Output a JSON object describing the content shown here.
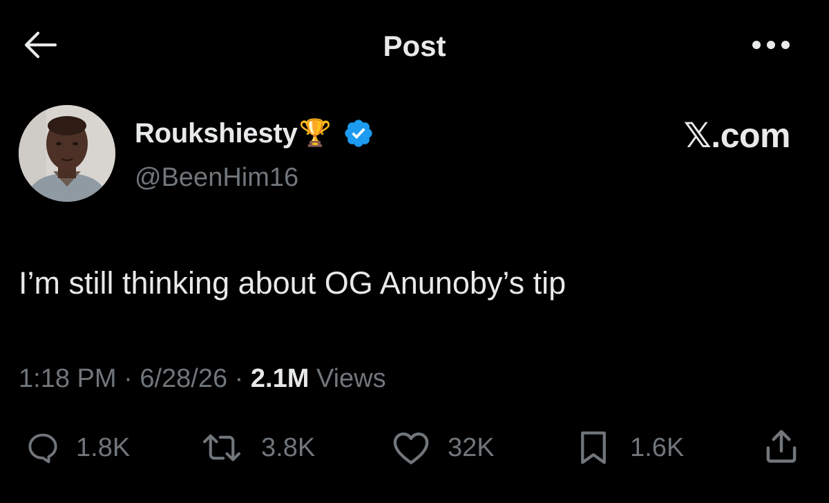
{
  "header": {
    "title": "Post",
    "back_icon": "arrow-left-icon",
    "more_icon": "more-horizontal-icon"
  },
  "author": {
    "display_name": "Roukshiesty",
    "emoji": "🏆",
    "handle": "@BeenHim16",
    "verified": true,
    "verified_color": "#1d9bf0"
  },
  "watermark": "𝕏.com",
  "tweet": {
    "text": "I’m still thinking about OG Anunoby’s tip"
  },
  "meta": {
    "time": "1:18 PM",
    "sep1": "·",
    "date": "6/28/26",
    "sep2": "·",
    "views_count": "2.1M",
    "views_label": "Views"
  },
  "actions": {
    "replies": "1.8K",
    "reposts": "3.8K",
    "likes": "32K",
    "bookmarks": "1.6K"
  },
  "colors": {
    "background": "#000000",
    "primary_text": "#e7e9ea",
    "secondary_text": "#71767b",
    "accent": "#1d9bf0"
  }
}
